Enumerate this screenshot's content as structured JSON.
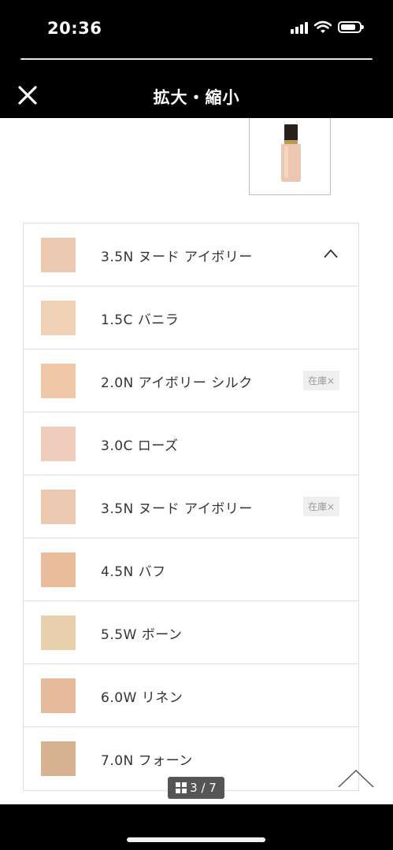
{
  "status_bar": {
    "time": "20:36",
    "icons": [
      "signal-icon",
      "wifi-icon",
      "battery-icon"
    ]
  },
  "header": {
    "title": "拡大・縮小",
    "close_icon": "close-icon"
  },
  "product_thumbnail": {
    "icon": "foundation-bottle-icon"
  },
  "selected_shade": {
    "label": "3.5N ヌード アイボリー",
    "swatch_color": "#ecc9b0",
    "expand_icon": "chevron-up-icon"
  },
  "shades": [
    {
      "label": "1.5C バニラ",
      "swatch_color": "#efd2b5",
      "badge": ""
    },
    {
      "label": "2.0N アイボリー シルク",
      "swatch_color": "#f0c8a8",
      "badge": "在庫×"
    },
    {
      "label": "3.0C ローズ",
      "swatch_color": "#efcbbb",
      "badge": ""
    },
    {
      "label": "3.5N ヌード アイボリー",
      "swatch_color": "#ecc9b0",
      "badge": "在庫×"
    },
    {
      "label": "4.5N バフ",
      "swatch_color": "#e9bc9b",
      "badge": ""
    },
    {
      "label": "5.5W ボーン",
      "swatch_color": "#e8cfad",
      "badge": ""
    },
    {
      "label": "6.0W リネン",
      "swatch_color": "#e6bb9c",
      "badge": ""
    },
    {
      "label": "7.0N フォーン",
      "swatch_color": "#d6b291",
      "badge": ""
    }
  ],
  "page_indicator": {
    "icon": "grid-icon",
    "text": "3 / 7",
    "current": 3,
    "total": 7
  },
  "scroll_top": {
    "icon": "chevron-up-icon"
  }
}
